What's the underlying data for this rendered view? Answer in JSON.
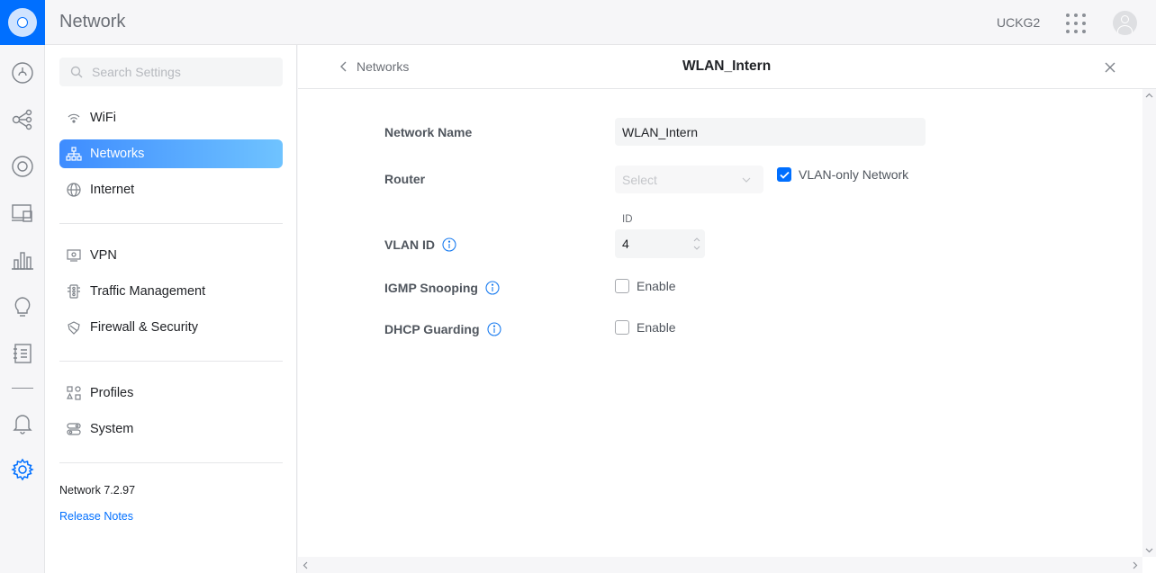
{
  "header": {
    "app_title": "Network",
    "console_name": "UCKG2"
  },
  "search": {
    "placeholder": "Search Settings"
  },
  "sidebar": {
    "items": [
      {
        "label": "WiFi",
        "icon": "wifi-icon"
      },
      {
        "label": "Networks",
        "icon": "networks-icon",
        "active": true
      },
      {
        "label": "Internet",
        "icon": "globe-icon"
      },
      {
        "label": "VPN",
        "icon": "vpn-icon"
      },
      {
        "label": "Traffic Management",
        "icon": "traffic-icon"
      },
      {
        "label": "Firewall & Security",
        "icon": "shield-icon"
      },
      {
        "label": "Profiles",
        "icon": "profiles-icon"
      },
      {
        "label": "System",
        "icon": "system-icon"
      }
    ],
    "version": "Network 7.2.97",
    "release_notes": "Release Notes"
  },
  "panel": {
    "back_label": "Networks",
    "title": "WLAN_Intern",
    "fields": {
      "network_name": {
        "label": "Network Name",
        "value": "WLAN_Intern"
      },
      "router": {
        "label": "Router",
        "placeholder": "Select",
        "vlan_only_label": "VLAN-only Network",
        "vlan_only_checked": true
      },
      "vlan_id": {
        "label": "VLAN ID",
        "sub_label": "ID",
        "value": "4"
      },
      "igmp": {
        "label": "IGMP Snooping",
        "option": "Enable",
        "checked": false
      },
      "dhcp": {
        "label": "DHCP Guarding",
        "option": "Enable",
        "checked": false
      }
    }
  },
  "colors": {
    "accent": "#006fff",
    "active_gradient_start": "#3e8cff",
    "active_gradient_end": "#6fc3ff"
  }
}
